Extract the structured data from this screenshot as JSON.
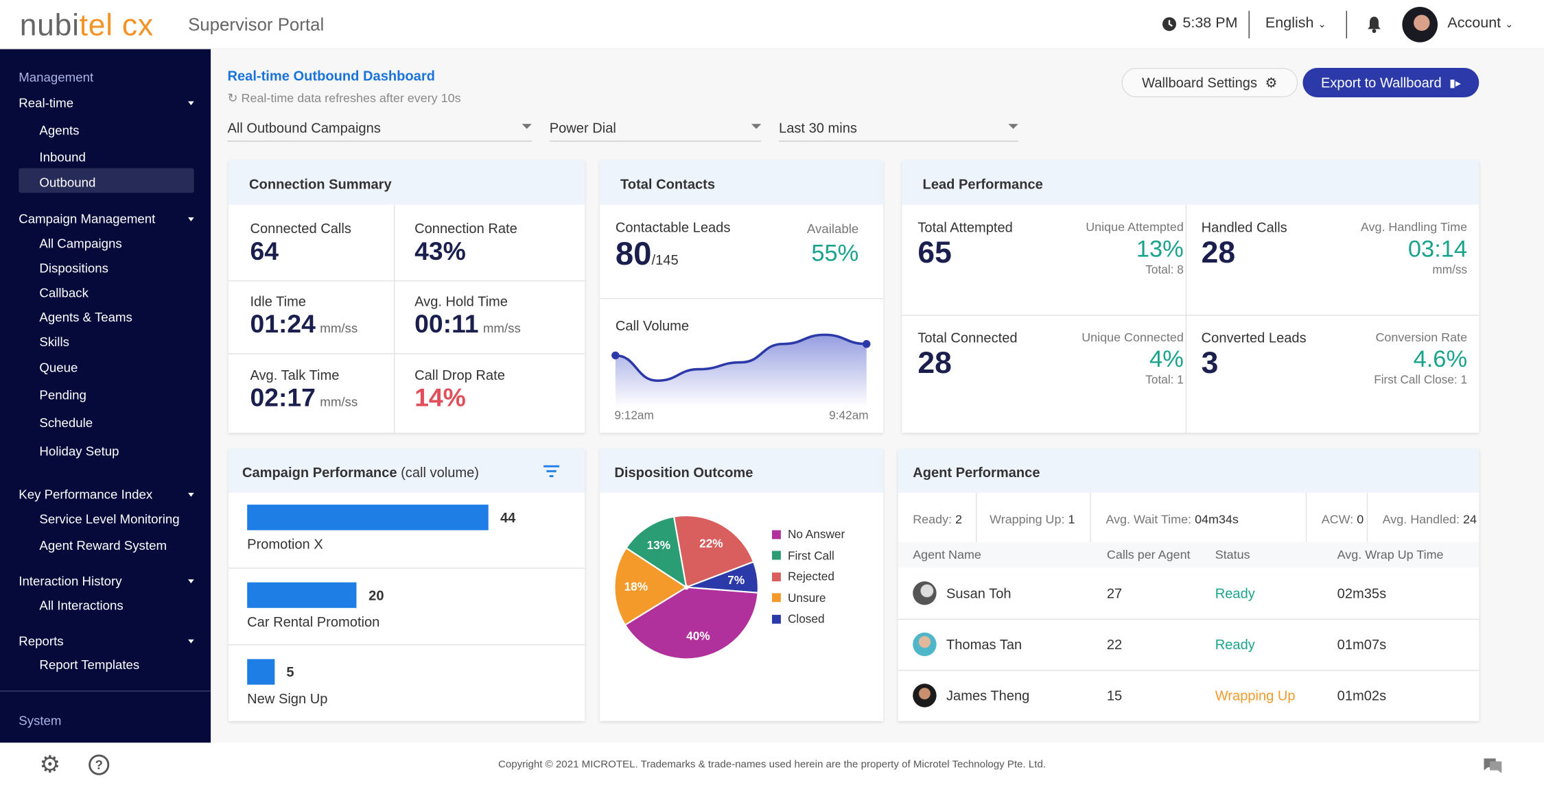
{
  "header": {
    "logo_text": "nubitel cx",
    "portal_title": "Supervisor Portal",
    "time": "5:38 PM",
    "language": "English",
    "account": "Account",
    "icons": [
      "clock-icon",
      "bell-icon",
      "avatar",
      "chevron-down-icon"
    ]
  },
  "sidebar": {
    "sections": [
      {
        "label": "Management",
        "type": "heading"
      },
      {
        "label": "Real-time",
        "items": [
          "Agents",
          "Inbound",
          "Outbound"
        ],
        "active": "Outbound"
      },
      {
        "label": "Campaign Management",
        "items": [
          "All Campaigns",
          "Dispositions",
          "Callback",
          "Agents & Teams",
          "Skills",
          "Queue",
          "Pending",
          "Schedule",
          "Holiday Setup"
        ]
      },
      {
        "label": "Key Performance Index",
        "items": [
          "Service Level Monitoring",
          "Agent Reward System"
        ]
      },
      {
        "label": "Interaction History",
        "items": [
          "All Interactions"
        ]
      },
      {
        "label": "Reports",
        "items": [
          "Report Templates"
        ]
      },
      {
        "label": "System",
        "type": "heading"
      }
    ]
  },
  "page": {
    "title": "Real-time Outbound Dashboard",
    "subtitle": "Real-time data refreshes after every 10s",
    "wallboard_settings": "Wallboard Settings",
    "export": "Export to Wallboard"
  },
  "filters": {
    "campaign": "All Outbound Campaigns",
    "dial_mode": "Power Dial",
    "period": "Last 30 mins"
  },
  "connection_summary": {
    "title": "Connection Summary",
    "metrics": [
      {
        "label": "Connected Calls",
        "value": "64",
        "unit": ""
      },
      {
        "label": "Connection Rate",
        "value": "43%",
        "unit": ""
      },
      {
        "label": "Idle Time",
        "value": "01:24",
        "unit": "mm/ss"
      },
      {
        "label": "Avg. Hold Time",
        "value": "00:11",
        "unit": "mm/ss"
      },
      {
        "label": "Avg. Talk Time",
        "value": "02:17",
        "unit": "mm/ss"
      },
      {
        "label": "Call Drop Rate",
        "value": "14%",
        "unit": ""
      }
    ]
  },
  "total_contacts": {
    "title": "Total Contacts",
    "contactable_label": "Contactable Leads",
    "contactable": "80",
    "total": "/145",
    "available_label": "Available",
    "available": "55%",
    "call_volume_label": "Call Volume",
    "x_start": "9:12am",
    "x_end": "9:42am"
  },
  "lead_performance": {
    "title": "Lead Performance",
    "cells": [
      {
        "label": "Total Attempted",
        "value": "65",
        "side_label": "Unique Attempted",
        "side_value": "13%",
        "side_note": "Total: 8"
      },
      {
        "label": "Handled Calls",
        "value": "28",
        "side_label": "Avg. Handling Time",
        "side_value": "03:14",
        "side_note": "mm/ss"
      },
      {
        "label": "Total Connected",
        "value": "28",
        "side_label": "Unique Connected",
        "side_value": "4%",
        "side_note": "Total: 1"
      },
      {
        "label": "Converted Leads",
        "value": "3",
        "side_label": "Conversion Rate",
        "side_value": "4.6%",
        "side_note": "First Call Close: 1"
      }
    ]
  },
  "campaign_performance": {
    "title": "Campaign Performance",
    "title_suffix": "(call volume)",
    "rows": [
      {
        "name": "Promotion X",
        "value": 44
      },
      {
        "name": "Car Rental Promotion",
        "value": 20
      },
      {
        "name": "New Sign Up",
        "value": 5
      }
    ]
  },
  "disposition": {
    "title": "Disposition Outcome"
  },
  "agent_performance": {
    "title": "Agent Performance",
    "summary": [
      {
        "label": "Ready:",
        "value": "2"
      },
      {
        "label": "Wrapping Up:",
        "value": "1"
      },
      {
        "label": "Avg. Wait Time:",
        "value": "04m34s"
      },
      {
        "label": "ACW:",
        "value": "0"
      },
      {
        "label": "Avg. Handled:",
        "value": "24"
      }
    ],
    "columns": [
      "Agent Name",
      "Calls per Agent",
      "Status",
      "Avg. Wrap Up Time"
    ],
    "rows": [
      {
        "name": "Susan Toh",
        "calls": "27",
        "status": "Ready",
        "wrap": "02m35s"
      },
      {
        "name": "Thomas Tan",
        "calls": "22",
        "status": "Ready",
        "wrap": "01m07s"
      },
      {
        "name": "James Theng",
        "calls": "15",
        "status": "Wrapping Up",
        "wrap": "01m02s"
      }
    ]
  },
  "footer": {
    "copyright": "Copyright © 2021 MICROTEL. Trademarks & trade-names used herein are the property of Microtel Technology Pte. Ltd."
  },
  "colors": {
    "sidebar": "#050a3a",
    "accent": "#2b3aa8",
    "link": "#1a73d9",
    "ready": "#1aa38c",
    "wrapping": "#f39a2a",
    "drop": "#e0505a",
    "bar": "#1f7de6"
  },
  "chart_data": [
    {
      "type": "pie",
      "title": "Disposition Outcome",
      "legend": "right",
      "slices": [
        {
          "name": "Rejected",
          "value": 22,
          "color": "#d95f5f"
        },
        {
          "name": "Closed",
          "value": 7,
          "color": "#2b3aa8"
        },
        {
          "name": "No Answer",
          "value": 40,
          "color": "#b0309c"
        },
        {
          "name": "Unsure",
          "value": 18,
          "color": "#f39a2a"
        },
        {
          "name": "First Call",
          "value": 13,
          "color": "#2a9d74"
        }
      ],
      "legend_order": [
        "No Answer",
        "First Call",
        "Rejected",
        "Unsure",
        "Closed"
      ]
    },
    {
      "type": "area",
      "title": "Call Volume",
      "x": [
        "9:12am",
        "",
        "",
        "",
        "",
        "",
        "9:42am"
      ],
      "values": [
        40,
        18,
        28,
        34,
        50,
        58,
        50
      ]
    },
    {
      "type": "bar",
      "title": "Campaign Performance",
      "categories": [
        "Promotion X",
        "Car Rental Promotion",
        "New Sign Up"
      ],
      "values": [
        44,
        20,
        5
      ]
    }
  ]
}
